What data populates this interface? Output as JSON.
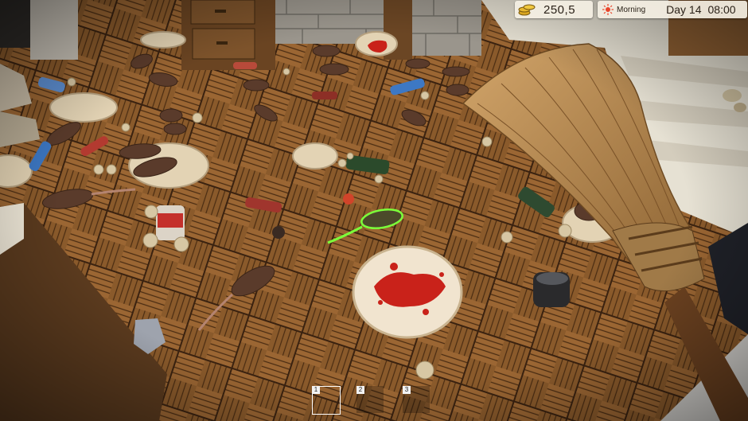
{
  "hud": {
    "money": "250,5",
    "time_of_day": "Morning",
    "day": "Day 14",
    "clock": "08:00"
  },
  "hotbar": [
    {
      "number": "1",
      "selected": true
    },
    {
      "number": "2",
      "selected": false
    },
    {
      "number": "3",
      "selected": false
    }
  ],
  "colors": {
    "highlight_outline": "#7cff3a",
    "hud_bg": "#f5f0e4",
    "sun": "#e8452b"
  },
  "icons": [
    "coins-icon",
    "sun-icon",
    "moon-icon",
    "broom-icon",
    "rat-icon"
  ]
}
